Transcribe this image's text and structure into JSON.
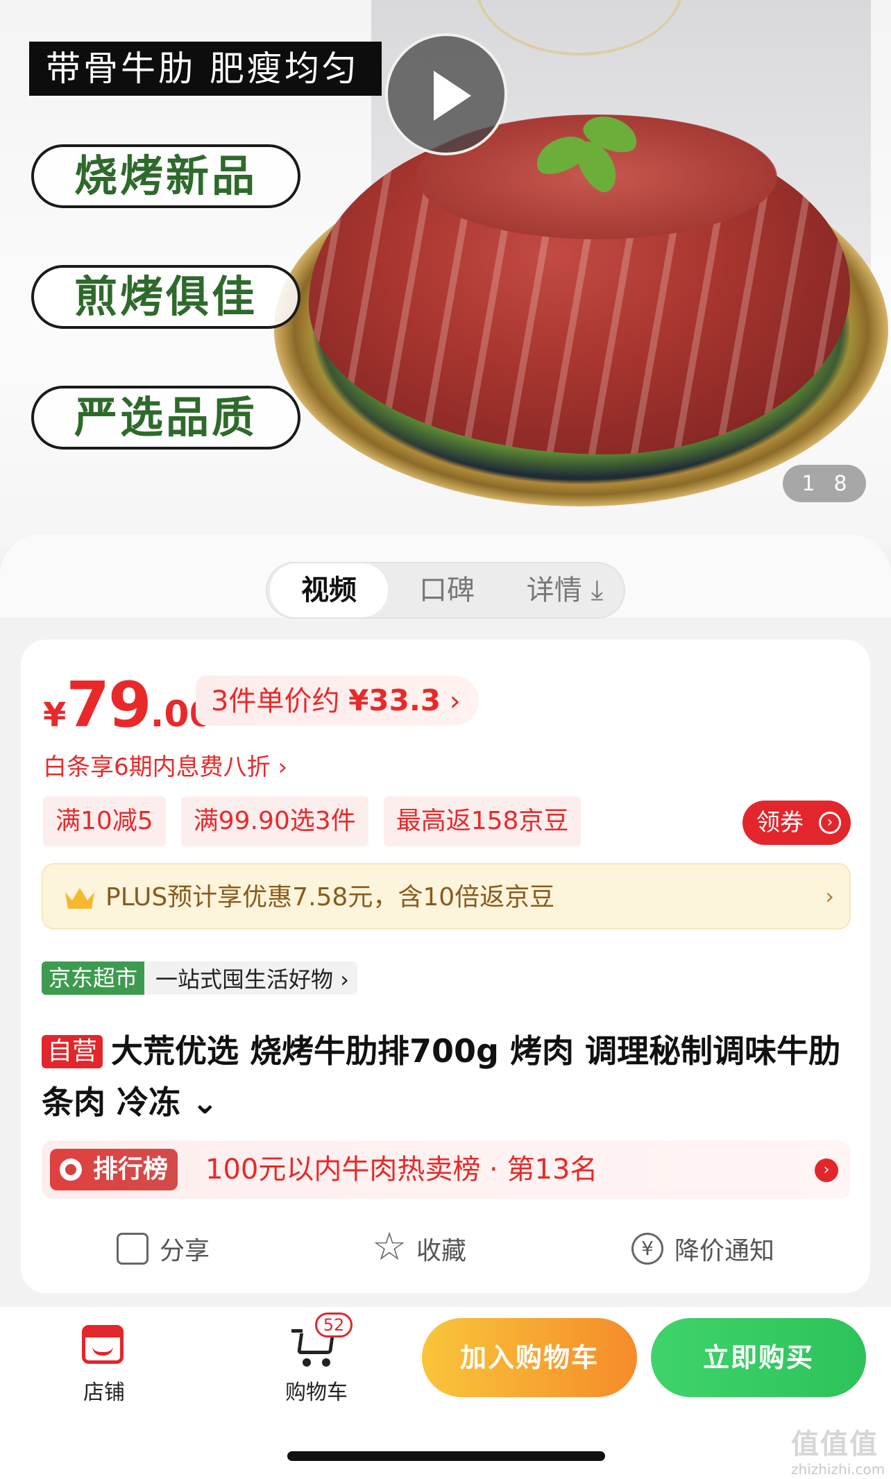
{
  "hero": {
    "headline": "带骨牛肋 肥瘦均匀",
    "tags": [
      "烧烤新品",
      "煎烤俱佳",
      "严选品质"
    ],
    "pager": {
      "current": "1",
      "total": "8"
    }
  },
  "tabs": [
    {
      "label": "视频",
      "active": true
    },
    {
      "label": "口碑",
      "active": false
    },
    {
      "label": "详情 ⤓",
      "active": false
    }
  ],
  "price": {
    "currency": "¥",
    "integer": "79",
    "decimal": ".00",
    "multi_label": "3件单价约 ",
    "multi_price": "¥33.3",
    "multi_arrow": "›",
    "baitiao": "白条享6期内息费八折 ›"
  },
  "promos": [
    "满10减5",
    "满99.90选3件",
    "最高返158京豆"
  ],
  "coupon_label": "领券",
  "coupon_arrow": "›",
  "plus": {
    "text": "PLUS预计享优惠7.58元，含10倍返京豆",
    "arrow": "›"
  },
  "store_tag": {
    "label": "京东超市",
    "slogan": "一站式囤生活好物 ›"
  },
  "product": {
    "self_tag": "自营",
    "title": "大荒优选 烧烤牛肋排700g 烤肉 调理秘制调味牛肋条肉 冷冻",
    "expand": " ⌄"
  },
  "rank": {
    "badge": "排行榜",
    "text": "100元以内牛肉热卖榜 · 第13名",
    "arrow": "›"
  },
  "actions": [
    {
      "label": "分享",
      "icon": "share-icon"
    },
    {
      "label": "收藏",
      "icon": "star-icon"
    },
    {
      "label": "降价通知",
      "icon": "price-drop-icon"
    }
  ],
  "bottom_bar": {
    "store_label": "店铺",
    "cart_label": "购物车",
    "cart_count": "52",
    "add_to_cart": "加入购物车",
    "buy_now": "立即购买"
  },
  "watermark": {
    "logo": "值值值",
    "site": "zhizhizhi.com"
  },
  "colors": {
    "price_red": "#e8292a",
    "buy_green": "#2ec25b",
    "cart_orange": "#f58b2a",
    "jd_mart_green": "#3d9b4f",
    "plus_gold": "#8a5a1c"
  }
}
